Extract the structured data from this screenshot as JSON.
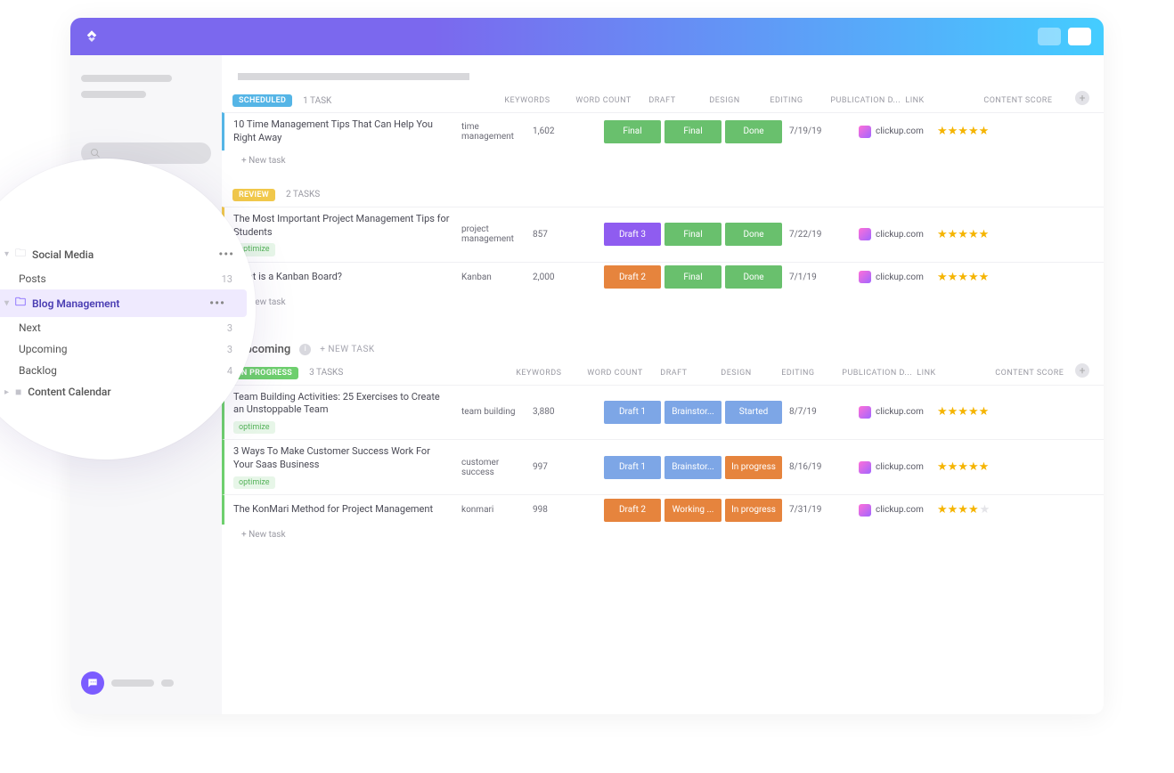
{
  "sidebar_tree": {
    "social_media": {
      "label": "Social Media",
      "posts_label": "Posts",
      "posts_count": "13"
    },
    "blog_management": {
      "label": "Blog Management",
      "next_label": "Next",
      "next_count": "3",
      "upcoming_label": "Upcoming",
      "upcoming_count": "3",
      "backlog_label": "Backlog",
      "backlog_count": "4"
    },
    "content_calendar": {
      "label": "Content Calendar"
    }
  },
  "columns": {
    "keywords": "KEYWORDS",
    "word_count": "WORD COUNT",
    "draft": "DRAFT",
    "design": "DESIGN",
    "editing": "EDITING",
    "publication": "PUBLICATION D...",
    "link": "LINK",
    "content_score": "CONTENT SCORE"
  },
  "statuses": {
    "scheduled": {
      "label": "SCHEDULED",
      "count": "1 TASK"
    },
    "review": {
      "label": "REVIEW",
      "count": "2 TASKS"
    },
    "inprogress": {
      "label": "IN PROGRESS",
      "count": "3 TASKS"
    }
  },
  "cells": {
    "final": "Final",
    "done": "Done",
    "draft3": "Draft 3",
    "draft2": "Draft 2",
    "draft1": "Draft 1",
    "brainstor": "Brainstor...",
    "started": "Started",
    "inprogress": "In progress",
    "working": "Working ..."
  },
  "link_text": "clickup.com",
  "optimize_tag": "optimize",
  "new_task": "+ New task",
  "section": {
    "upcoming": "Upcoming",
    "new_task_upper": "+ NEW TASK"
  },
  "tasks": {
    "t1": {
      "title": "10 Time Management Tips That Can Help You Right Away",
      "keywords": "time management",
      "wc": "1,602",
      "date": "7/19/19",
      "stars": 5
    },
    "t2": {
      "title": "The Most Important Project Management Tips for Students",
      "keywords": "project management",
      "wc": "857",
      "date": "7/22/19",
      "stars": 5
    },
    "t3": {
      "title": "What is a Kanban Board?",
      "keywords": "Kanban",
      "wc": "2,000",
      "date": "7/1/19",
      "stars": 5
    },
    "t4": {
      "title": "Team Building Activities: 25 Exercises to Create an Unstoppable Team",
      "keywords": "team building",
      "wc": "3,880",
      "date": "8/7/19",
      "stars": 5
    },
    "t5": {
      "title": "3 Ways To Make Customer Success Work For Your Saas Business",
      "keywords": "customer success",
      "wc": "997",
      "date": "8/16/19",
      "stars": 5
    },
    "t6": {
      "title": "The KonMari Method for Project Management",
      "keywords": "konmari",
      "wc": "998",
      "date": "7/31/19",
      "stars": 4
    }
  }
}
